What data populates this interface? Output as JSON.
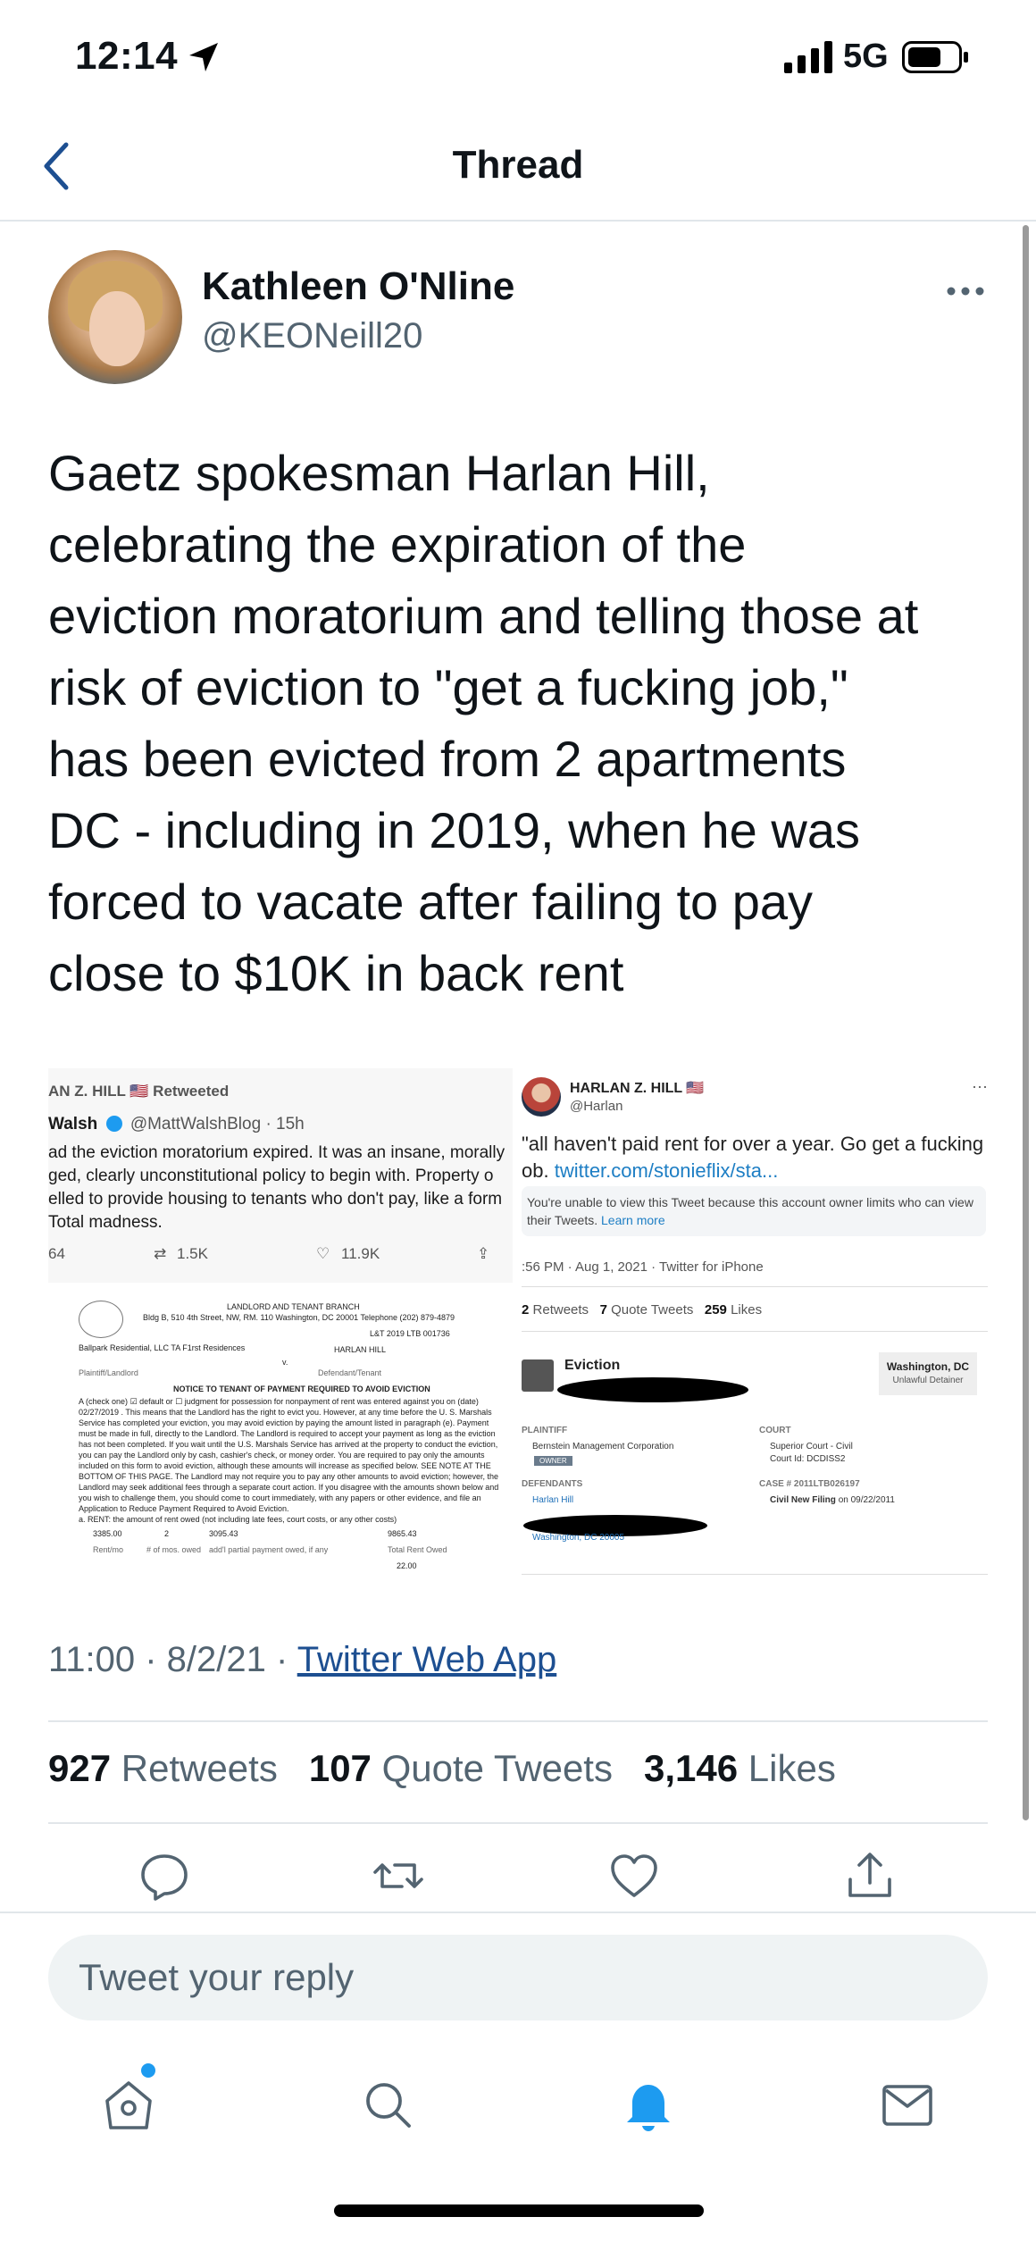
{
  "status_bar": {
    "time": "12:14",
    "network": "5G"
  },
  "nav": {
    "title": "Thread"
  },
  "author": {
    "name": "Kathleen O'Nline",
    "handle": "@KEONeill20"
  },
  "tweet": {
    "lines": [
      "Gaetz spokesman Harlan Hill,",
      "celebrating the expiration of the",
      "eviction moratorium and telling those at",
      "risk of eviction to \"get a fucking job,\"",
      "has been evicted from 2 apartments",
      "DC - including in 2019, when he was",
      "forced to vacate after failing to pay",
      "close to $10K in back rent"
    ]
  },
  "media": {
    "left_top": {
      "retweeted": "AN Z. HILL 🇺🇸 Retweeted",
      "author": "Walsh",
      "author_handle": "@MattWalshBlog · 15h",
      "lines": [
        "ad the eviction moratorium expired. It was an insane, morally",
        "ged, clearly unconstitutional policy to begin with. Property o",
        "elled to provide housing to tenants who don't pay, like a form",
        " Total madness."
      ],
      "replies": "64",
      "retweets": "1.5K",
      "likes": "11.9K"
    },
    "left_bottom": {
      "header": "LANDLORD AND TENANT BRANCH",
      "address": "Bldg B, 510 4th Street, NW, RM. 110 Washington, DC 20001 Telephone (202) 879-4879",
      "case": "L&T 2019 LTB 001736",
      "plaintiff": "Ballpark Residential, LLC TA F1rst Residences",
      "defendant": "HARLAN HILL",
      "plaintiff_label": "Plaintiff/Landlord",
      "defendant_label": "Defendant/Tenant",
      "v": "v.",
      "notice_title": "NOTICE TO TENANT OF PAYMENT REQUIRED TO AVOID EVICTION",
      "notice_lines": [
        "A (check one) ☑ default or ☐ judgment for possession for nonpayment of rent was entered against you on (date)",
        "02/27/2019 . This means that the Landlord has the right to evict you. However, at any time before the U. S. Marshals",
        "Service has completed your eviction, you may avoid eviction by paying the amount listed in paragraph (e). Payment",
        "must be made in full, directly to the Landlord. The Landlord is required to accept your payment as long as the eviction",
        "has not been completed. If you wait until the U.S. Marshals Service has arrived at the property to conduct the eviction,",
        "you can pay the Landlord only by cash, cashier's check, or money order. You are required to pay only the amounts",
        "included on this form to avoid eviction, although these amounts will increase as specified below. SEE NOTE AT THE",
        "BOTTOM OF THIS PAGE. The Landlord may not require you to pay any other amounts to avoid eviction; however, the",
        "Landlord may seek additional fees through a separate court action. If you disagree with the amounts shown below and",
        "you wish to challenge them, you should come to court immediately, with any papers or other evidence, and file an",
        "Application to Reduce Payment Required to Avoid Eviction.",
        "a. RENT: the amount of rent owed (not including late fees, court costs, or any other costs)"
      ],
      "rent_month": "3385.00",
      "num_months": "2",
      "partial": "3095.43",
      "total": "9865.43",
      "rent_label": "Rent/mo",
      "months_label": "# of mos. owed",
      "partial_label": "add'l partial payment owed, if any",
      "total_label": "Total Rent Owed",
      "footer_value": "22.00"
    },
    "right": {
      "name": "HARLAN Z. HILL 🇺🇸",
      "handle": "@Harlan",
      "dots": "···",
      "text_line1": "\"all haven't paid rent for over a year. Go get a fucking",
      "text_line2_prefix": "ob. ",
      "text_line2_link": "twitter.com/stonieflix/sta...",
      "notice": "You're unable to view this Tweet because this account owner limits who can view their Tweets.",
      "notice_link": "Learn more",
      "timestamp": ":56 PM · Aug 1, 2021 · Twitter for iPhone",
      "retweets": "2",
      "retweets_label": "Retweets",
      "quote": "7",
      "quote_label": "Quote Tweets",
      "likes": "259",
      "likes_label": "Likes",
      "eviction_title": "Eviction",
      "location": "Washington, DC",
      "location_sub": "Unlawful Detainer",
      "plaintiff_label": "PLAINTIFF",
      "plaintiff": "Bernstein Management Corporation",
      "owner_badge": "OWNER",
      "court_label": "COURT",
      "court": "Superior Court - Civil",
      "court_id": "Court Id: DCDISS2",
      "defendants_label": "DEFENDANTS",
      "defendant": "Harlan Hill",
      "case_label": "CASE # 2011LTB026197",
      "filing": "Civil New Filing",
      "filing_date": "on 09/22/2011",
      "address": "Washington, DC 20005"
    }
  },
  "meta": {
    "time": "11:00 · 8/2/21 · ",
    "source": "Twitter Web App"
  },
  "counts": {
    "retweets": "927",
    "retweets_label": "Retweets",
    "quotes": "107",
    "quotes_label": "Quote Tweets",
    "likes": "3,146",
    "likes_label": "Likes"
  },
  "reply": {
    "placeholder": "Tweet your reply"
  },
  "colors": {
    "accent": "#1d9bf0",
    "link": "#1d4f91",
    "secondary_text": "#536471"
  }
}
